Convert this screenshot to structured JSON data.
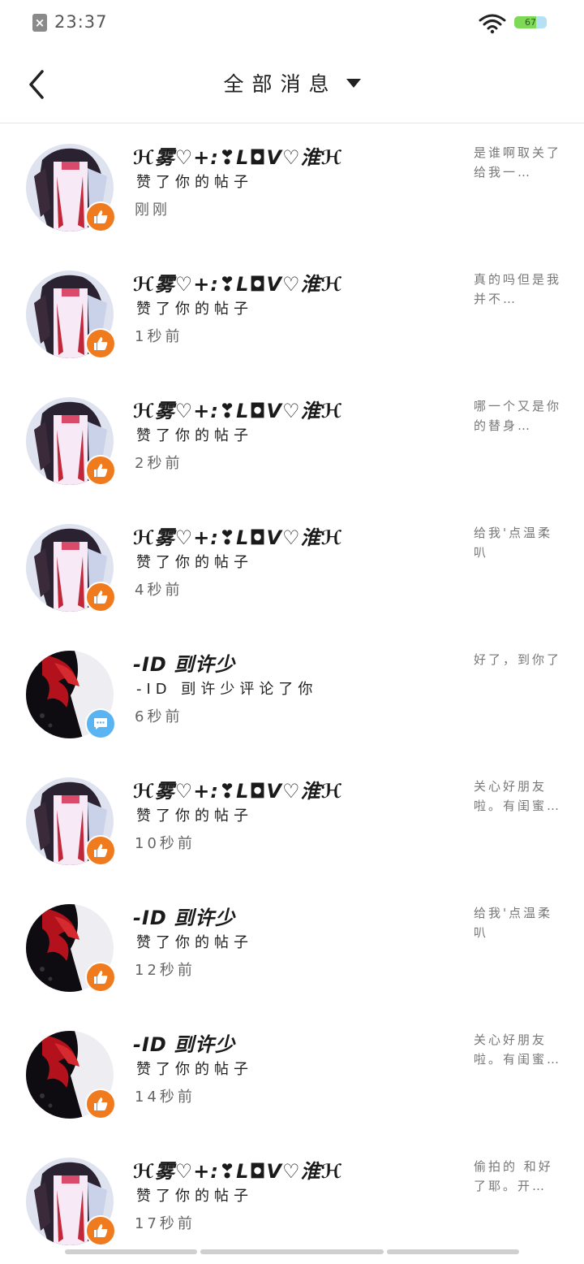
{
  "status_bar": {
    "time": "23:37",
    "battery_level": 67,
    "battery_text": "67",
    "sim_icon": "no-sim-icon",
    "wifi_icon": "wifi-icon"
  },
  "header": {
    "back_icon": "chevron-left-icon",
    "title": "全部消息",
    "dropdown_icon": "caret-down-icon"
  },
  "colors": {
    "like_badge": "#f07a1e",
    "comment_badge": "#5bb4f2",
    "time_text": "#666666",
    "snippet_text": "#777777"
  },
  "notifications": [
    {
      "avatar": "avatar-anime-girl-a",
      "badge": "like",
      "name": "ℋ雾♡+:❣L◘V♡淮ℋ",
      "action": "赞了你的帖子",
      "time": "刚刚",
      "snippet": "是谁啊取关了给我一…"
    },
    {
      "avatar": "avatar-anime-girl-a",
      "badge": "like",
      "name": "ℋ雾♡+:❣L◘V♡淮ℋ",
      "action": "赞了你的帖子",
      "time": "1秒前",
      "snippet": "真的吗但是我并不…"
    },
    {
      "avatar": "avatar-anime-girl-a",
      "badge": "like",
      "name": "ℋ雾♡+:❣L◘V♡淮ℋ",
      "action": "赞了你的帖子",
      "time": "2秒前",
      "snippet": "哪一个又是你的替身…"
    },
    {
      "avatar": "avatar-anime-girl-a",
      "badge": "like",
      "name": "ℋ雾♡+:❣L◘V♡淮ℋ",
      "action": "赞了你的帖子",
      "time": "4秒前",
      "snippet": "给我'点温柔叭"
    },
    {
      "avatar": "avatar-red-hair-b",
      "badge": "comment",
      "name": "-ID 刯许少",
      "action": "-ID 刯许少评论了你",
      "time": "6秒前",
      "snippet": "好了，到你了"
    },
    {
      "avatar": "avatar-anime-girl-a",
      "badge": "like",
      "name": "ℋ雾♡+:❣L◘V♡淮ℋ",
      "action": "赞了你的帖子",
      "time": "10秒前",
      "snippet": "关心好朋友啦。有闺蜜…"
    },
    {
      "avatar": "avatar-red-hair-b",
      "badge": "like",
      "name": "-ID 刯许少",
      "action": "赞了你的帖子",
      "time": "12秒前",
      "snippet": "给我'点温柔叭"
    },
    {
      "avatar": "avatar-red-hair-b",
      "badge": "like",
      "name": "-ID 刯许少",
      "action": "赞了你的帖子",
      "time": "14秒前",
      "snippet": "关心好朋友啦。有闺蜜…"
    },
    {
      "avatar": "avatar-anime-girl-a",
      "badge": "like",
      "name": "ℋ雾♡+:❣L◘V♡淮ℋ",
      "action": "赞了你的帖子",
      "time": "17秒前",
      "snippet": "偷拍的 和好了耶。开…"
    }
  ]
}
